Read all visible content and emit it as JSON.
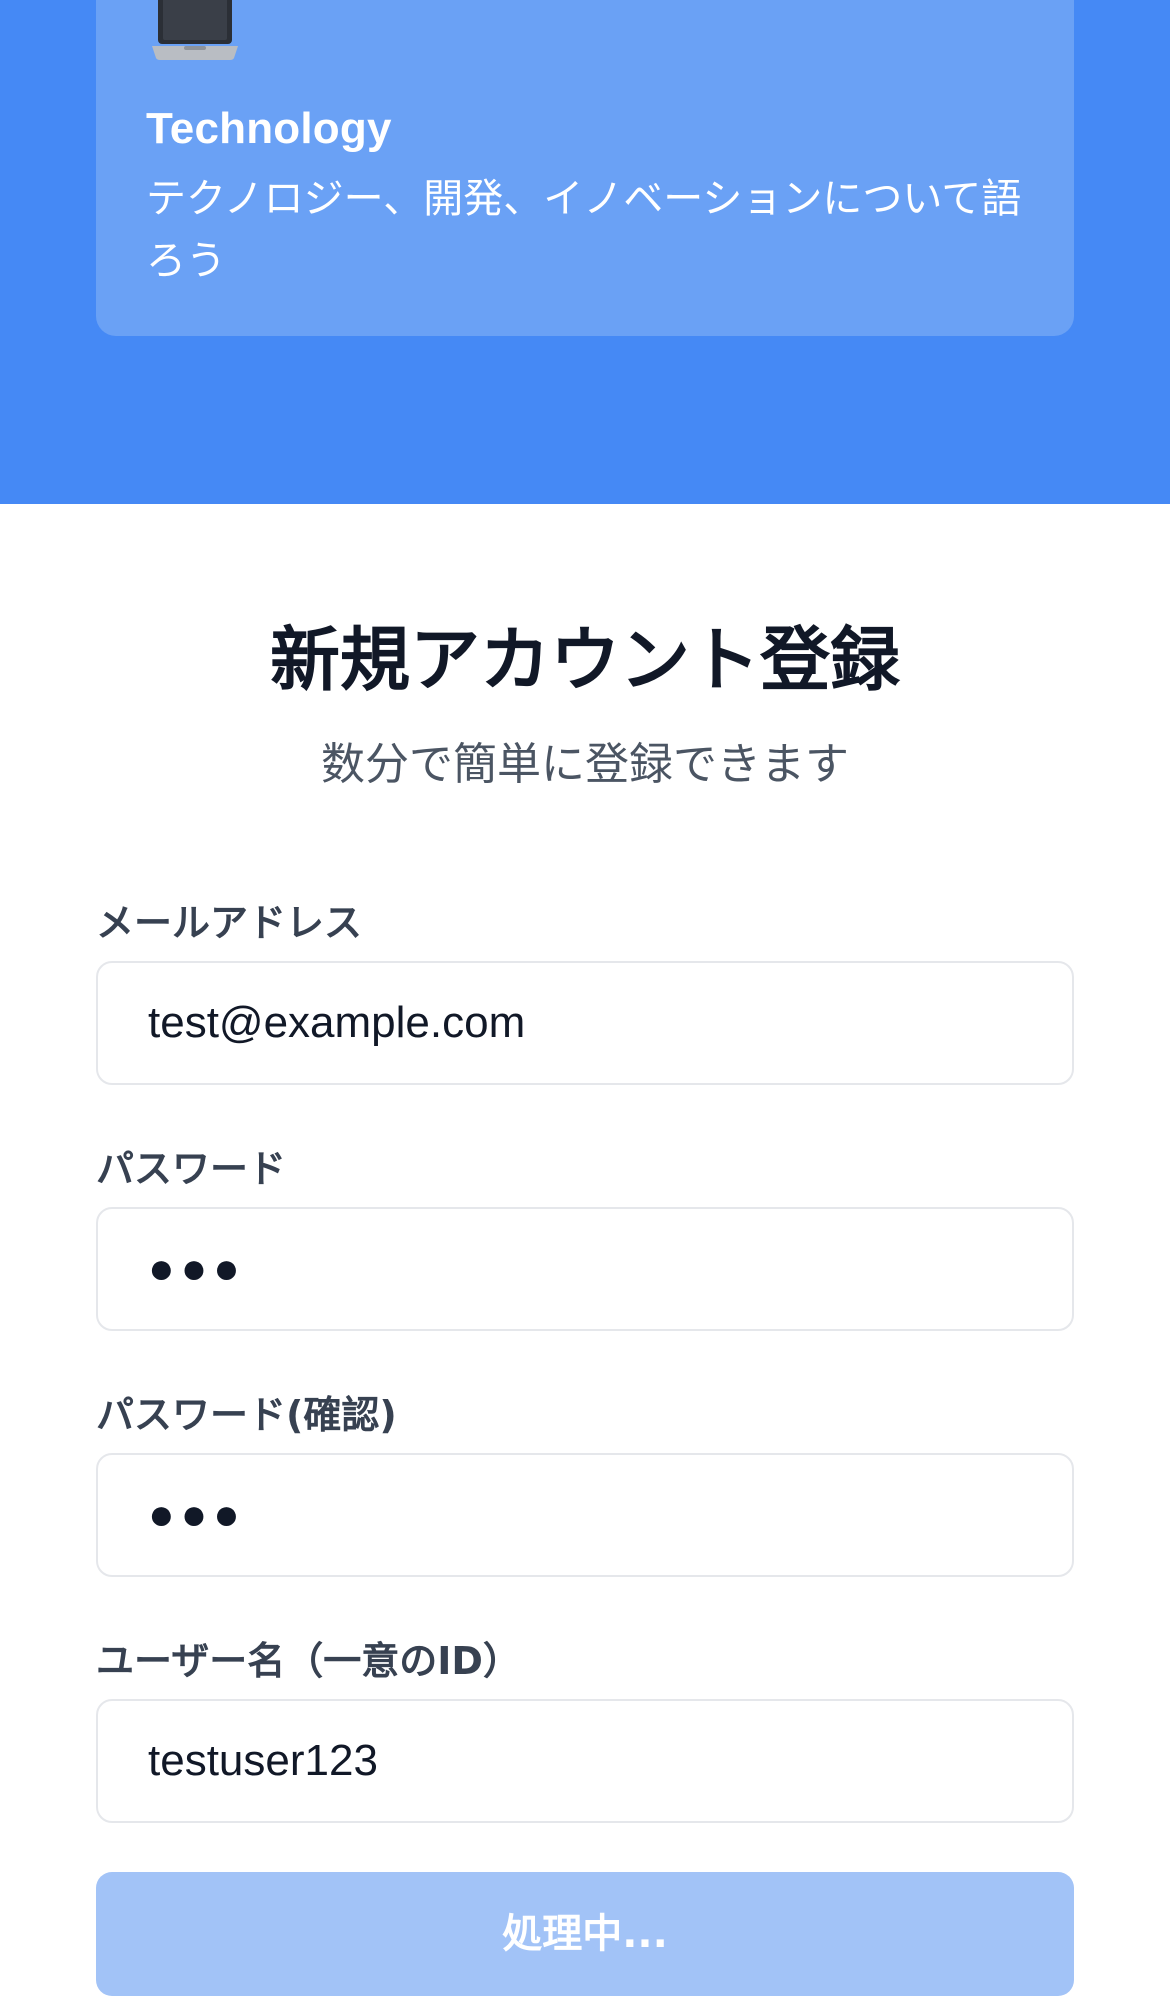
{
  "hero": {
    "card": {
      "icon": "laptop-icon",
      "title": "Technology",
      "description": "テクノロジー、開発、イノベーションについて語ろう"
    },
    "colors": {
      "background": "#4589f5",
      "card": "#6aa1f5"
    }
  },
  "form": {
    "title": "新規アカウント登録",
    "subtitle": "数分で簡単に登録できます",
    "fields": {
      "email": {
        "label": "メールアドレス",
        "value": "test@example.com"
      },
      "password": {
        "label": "パスワード",
        "value": "●●●"
      },
      "password_confirm": {
        "label": "パスワード(確認)",
        "value": "●●●"
      },
      "username": {
        "label": "ユーザー名（一意のID）",
        "value": "testuser123"
      }
    },
    "submit": {
      "label": "処理中...",
      "color": "#a2c3f7"
    }
  }
}
